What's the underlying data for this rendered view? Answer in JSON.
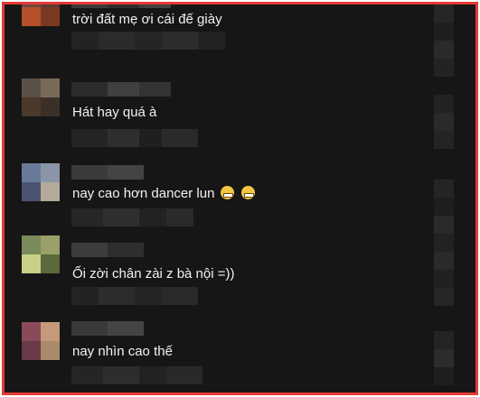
{
  "comments": [
    {
      "text": "trời đất mẹ ơi cái đế giày",
      "emojis": []
    },
    {
      "text": "Hát hay quá à",
      "emojis": []
    },
    {
      "text": "nay cao hơn dancer lun",
      "emojis": [
        "grinning-face-emoji",
        "grinning-face-emoji"
      ]
    },
    {
      "text": "Ối zời chân zài z bà nội =))",
      "emojis": []
    },
    {
      "text": "nay nhìn cao thế",
      "emojis": []
    }
  ],
  "colors": {
    "background": "#161616",
    "text": "#f2f2f2",
    "frame_border": "#e53935"
  }
}
